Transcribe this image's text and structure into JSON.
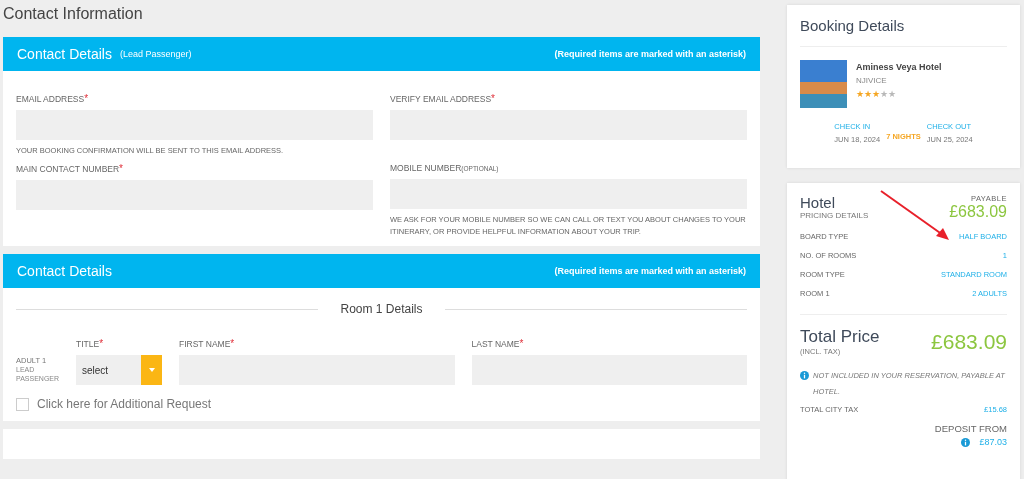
{
  "page_title": "Contact Information",
  "contact_panel": {
    "title": "Contact Details",
    "subtitle": "(Lead Passenger)",
    "note": "(Required items are marked with an asterisk)",
    "fields": [
      {
        "label": "EMAIL ADDRESS",
        "required_mark": "*",
        "hint": "YOUR BOOKING CONFIRMATION WILL BE SENT TO THIS EMAIL ADDRESS."
      },
      {
        "label": "VERIFY EMAIL ADDRESS",
        "required_mark": "*"
      },
      {
        "label": "MAIN CONTACT NUMBER",
        "required_mark": "*"
      },
      {
        "label": "MOBILE NUMBER",
        "tag": "(OPTIONAL)",
        "hint": "WE ASK FOR YOUR MOBILE NUMBER SO WE CAN CALL OR TEXT YOU ABOUT CHANGES TO YOUR ITINERARY, OR PROVIDE HELPFUL INFORMATION ABOUT YOUR TRIP."
      }
    ]
  },
  "passenger_panel": {
    "title": "Contact Details",
    "note": "(Required items are marked with an asterisk)",
    "room_heading": "Room 1 Details",
    "adult_label": "ADULT 1",
    "adult_sublabel": "LEAD PASSENGER",
    "title_field": {
      "label": "TITLE",
      "required_mark": "*",
      "value": "select"
    },
    "first_name": {
      "label": "FIRST NAME",
      "required_mark": "*"
    },
    "last_name": {
      "label": "LAST NAME",
      "required_mark": "*"
    },
    "additional_request": {
      "label": "Click here for Additional Request",
      "checked": false
    }
  },
  "booking": {
    "title": "Booking Details",
    "hotel_name": "Aminess Veya Hotel",
    "location": "NJIVICE",
    "stars": 3,
    "check_in_label": "CHECK IN",
    "check_in": "JUN 18, 2024",
    "nights": "7 NIGHTS",
    "check_out_label": "CHECK OUT",
    "check_out": "JUN 25, 2024"
  },
  "pricing": {
    "title": "Hotel",
    "subtitle": "PRICING DETAILS",
    "payable_label": "PAYABLE",
    "payable": "£683.09",
    "rows": [
      {
        "label": "BOARD TYPE",
        "value": "HALF BOARD"
      },
      {
        "label": "NO. OF ROOMS",
        "value": "1"
      },
      {
        "label": "ROOM TYPE",
        "value": "STANDARD ROOM"
      },
      {
        "label": "ROOM 1",
        "value": "2 ADULTS"
      }
    ],
    "total_label": "Total Price",
    "total_sub": "(INCL. TAX)",
    "total": "£683.09",
    "notice": "NOT INCLUDED IN YOUR RESERVATION, PAYABLE AT HOTEL.",
    "city_tax_label": "TOTAL CITY TAX",
    "city_tax": "£15.68",
    "deposit_label": "DEPOSIT FROM",
    "deposit": "£87.03"
  }
}
